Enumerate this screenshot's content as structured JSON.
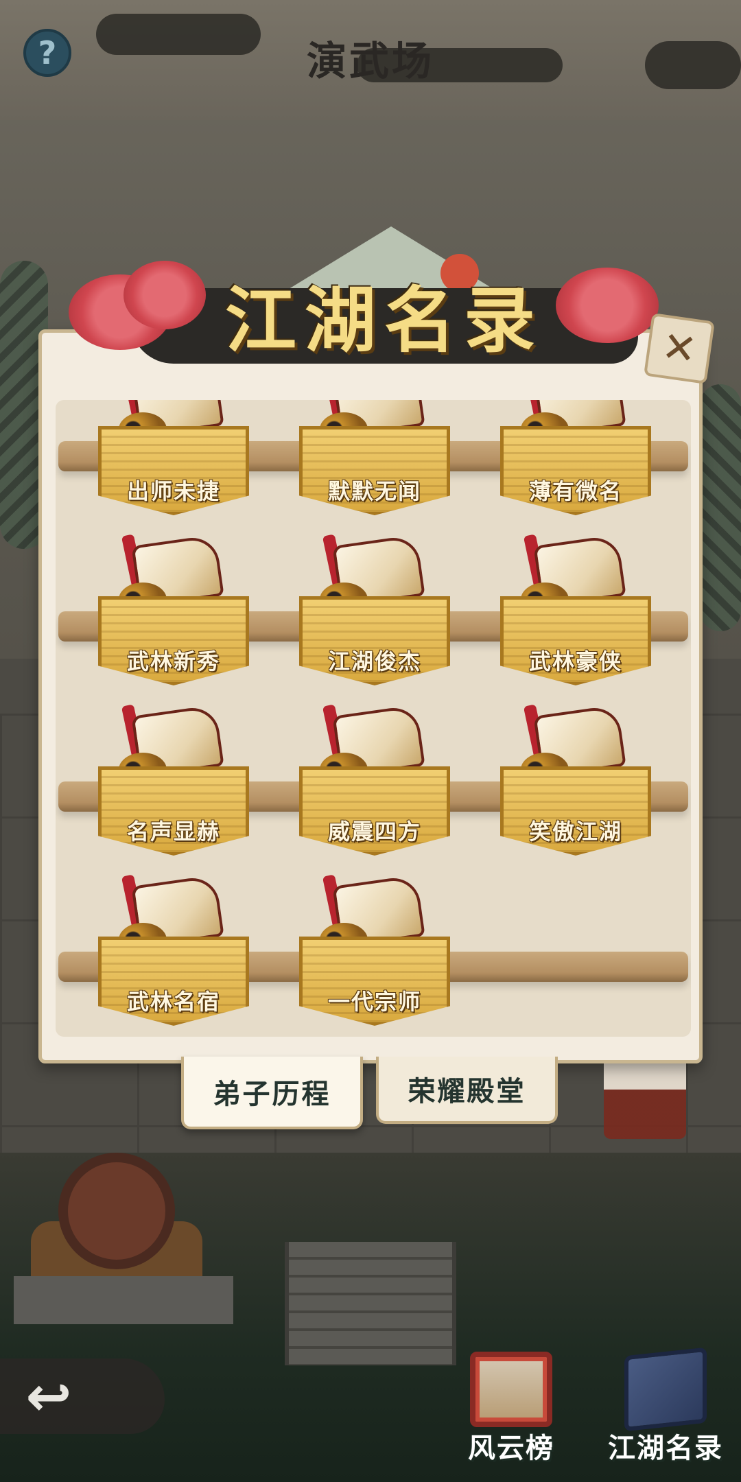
{
  "header": {
    "title": "演武场",
    "help_icon": "question-mark",
    "help_glyph": "?"
  },
  "dialog": {
    "title": "江湖名录",
    "close_glyph": "✕",
    "items": [
      {
        "label": "出师未捷"
      },
      {
        "label": "默默无闻"
      },
      {
        "label": "薄有微名"
      },
      {
        "label": "武林新秀"
      },
      {
        "label": "江湖俊杰"
      },
      {
        "label": "武林豪侠"
      },
      {
        "label": "名声显赫"
      },
      {
        "label": "威震四方"
      },
      {
        "label": "笑傲江湖"
      },
      {
        "label": "武林名宿"
      },
      {
        "label": "一代宗师"
      }
    ]
  },
  "tabs": [
    {
      "label": "弟子历程",
      "active": true
    },
    {
      "label": "荣耀殿堂",
      "active": false
    }
  ],
  "bottom_nav": {
    "back_glyph": "↩",
    "buttons": [
      {
        "label": "风云榜",
        "icon": "scroll-icon"
      },
      {
        "label": "江湖名录",
        "icon": "book-icon"
      }
    ]
  },
  "colors": {
    "accent_gold": "#f5dc86",
    "plaque_gold": "#d9a93e",
    "tab_text": "#24342f"
  }
}
